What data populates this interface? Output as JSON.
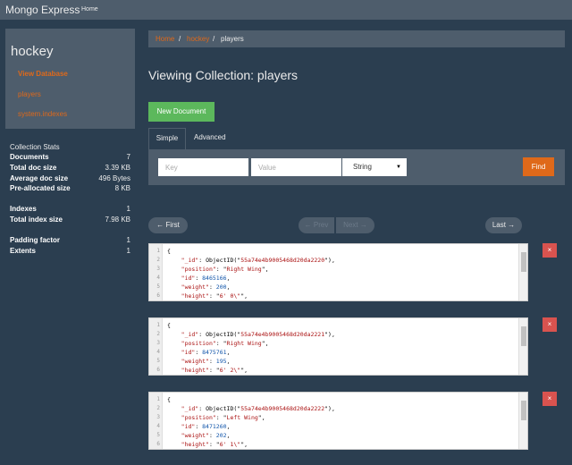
{
  "nav": {
    "brand": "Mongo Express",
    "home": "Home"
  },
  "sidebar": {
    "db_name": "hockey",
    "links": [
      "View Database",
      "players",
      "system.indexes"
    ]
  },
  "stats": {
    "title": "Collection Stats",
    "rows": [
      {
        "label": "Documents",
        "value": "7"
      },
      {
        "label": "Total doc size",
        "value": "3.39 KB"
      },
      {
        "label": "Average doc size",
        "value": "496 Bytes"
      },
      {
        "label": "Pre-allocated size",
        "value": "8 KB"
      },
      {
        "label": "Indexes",
        "value": "1"
      },
      {
        "label": "Total index size",
        "value": "7.98 KB"
      },
      {
        "label": "Padding factor",
        "value": "1"
      },
      {
        "label": "Extents",
        "value": "1"
      }
    ]
  },
  "breadcrumb": {
    "home": "Home",
    "db": "hockey",
    "current": "players",
    "sep": "/"
  },
  "page_title": "Viewing Collection: players",
  "new_document": "New Document",
  "tabs": {
    "simple": "Simple",
    "advanced": "Advanced"
  },
  "search": {
    "key_placeholder": "Key",
    "value_placeholder": "Value",
    "type": "String",
    "find": "Find"
  },
  "pager": {
    "first": "← First",
    "prev": "← Prev",
    "next": "Next →",
    "last": "Last →"
  },
  "documents": [
    {
      "id": "55a74e4b9005468d20da2220",
      "position": "Right Wing",
      "pid": "8465166",
      "weight": "200",
      "height": "6' 0\\\""
    },
    {
      "id": "55a74e4b9005468d20da2221",
      "position": "Right Wing",
      "pid": "8475761",
      "weight": "195",
      "height": "6' 2\\\""
    },
    {
      "id": "55a74e4b9005468d20da2222",
      "position": "Left Wing",
      "pid": "8471260",
      "weight": "202",
      "height": "6' 1\\\""
    }
  ],
  "code_text": {
    "brace": "{",
    "oid": "ObjectID",
    "k_id": "\"_id\"",
    "k_position": "\"position\"",
    "k_idnum": "\"id\"",
    "k_weight": "\"weight\"",
    "k_height": "\"height\""
  },
  "delete_label": "×",
  "colors": {
    "accent": "#df691a",
    "success": "#5cb85c",
    "danger": "#d9534f",
    "panel": "#4e5d6c",
    "bg": "#2b3e50"
  }
}
